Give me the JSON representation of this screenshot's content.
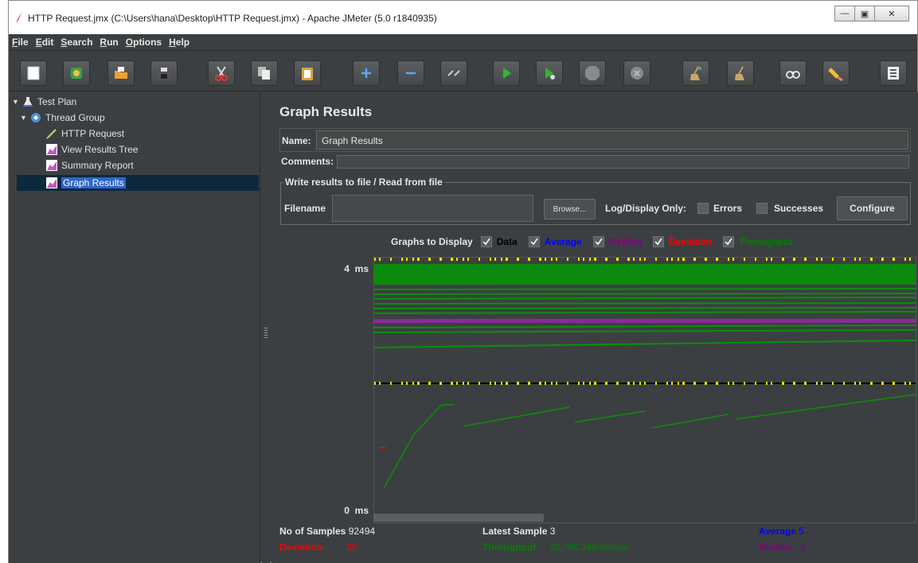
{
  "window": {
    "title": "HTTP Request.jmx (C:\\Users\\hana\\Desktop\\HTTP Request.jmx) - Apache JMeter (5.0 r1840935)"
  },
  "menu": [
    {
      "label": "File",
      "u": "F",
      "rest": "ile"
    },
    {
      "label": "Edit",
      "u": "E",
      "rest": "dit"
    },
    {
      "label": "Search",
      "u": "S",
      "rest": "earch"
    },
    {
      "label": "Run",
      "u": "R",
      "rest": "un"
    },
    {
      "label": "Options",
      "u": "O",
      "rest": "ptions"
    },
    {
      "label": "Help",
      "u": "H",
      "rest": "elp"
    }
  ],
  "toolbar": {
    "buttons": [
      "new-icon",
      "templates-icon",
      "open-icon",
      "save-icon",
      "cut-icon",
      "copy-icon",
      "paste-icon",
      "expand-icon",
      "collapse-icon",
      "toggle-icon",
      "start-icon",
      "start-no-pause-icon",
      "stop-icon",
      "shutdown-icon",
      "clear-icon",
      "clear-all-icon",
      "search-icon",
      "reset-search-icon",
      "function-helper-icon"
    ]
  },
  "tree": {
    "test_plan": "Test Plan",
    "thread_group": "Thread Group",
    "http_request": "HTTP Request",
    "view_results_tree": "View Results Tree",
    "summary_report": "Summary Report",
    "graph_results": "Graph Results"
  },
  "panel": {
    "title": "Graph Results",
    "name_label": "Name:",
    "name_value": "Graph Results",
    "comments_label": "Comments:",
    "file_legend": "Write results to file / Read from file",
    "filename_label": "Filename",
    "browse": "Browse...",
    "log_display": "Log/Display Only:",
    "errors": "Errors",
    "successes": "Successes",
    "configure": "Configure"
  },
  "graphs_to_display": {
    "label": "Graphs to Display",
    "options": [
      {
        "label": "Data",
        "color": "#000000",
        "checked": true
      },
      {
        "label": "Average",
        "color": "#0000ff",
        "checked": true
      },
      {
        "label": "Median",
        "color": "#800080",
        "checked": true
      },
      {
        "label": "Deviation",
        "color": "#ff0000",
        "checked": true
      },
      {
        "label": "Throughput",
        "color": "#008000",
        "checked": true
      }
    ]
  },
  "graph": {
    "y_max": "4",
    "y_min": "0",
    "unit": "ms"
  },
  "stats": {
    "samples_label": "No of Samples",
    "samples_value": "92494",
    "latest_label": "Latest Sample",
    "latest_value": "3",
    "average_label": "Average",
    "average_value": "5",
    "deviation_label": "Deviation",
    "deviation_value": "35",
    "throughput_label": "Throughput",
    "throughput_value": "10,798,246/minute",
    "median_label": "Median",
    "median_value": "3"
  },
  "colors": {
    "data": "#000000",
    "average": "#0000ff",
    "median": "#800080",
    "deviation": "#ff0000",
    "throughput": "#008000",
    "sample_marks": "#e8e800"
  }
}
